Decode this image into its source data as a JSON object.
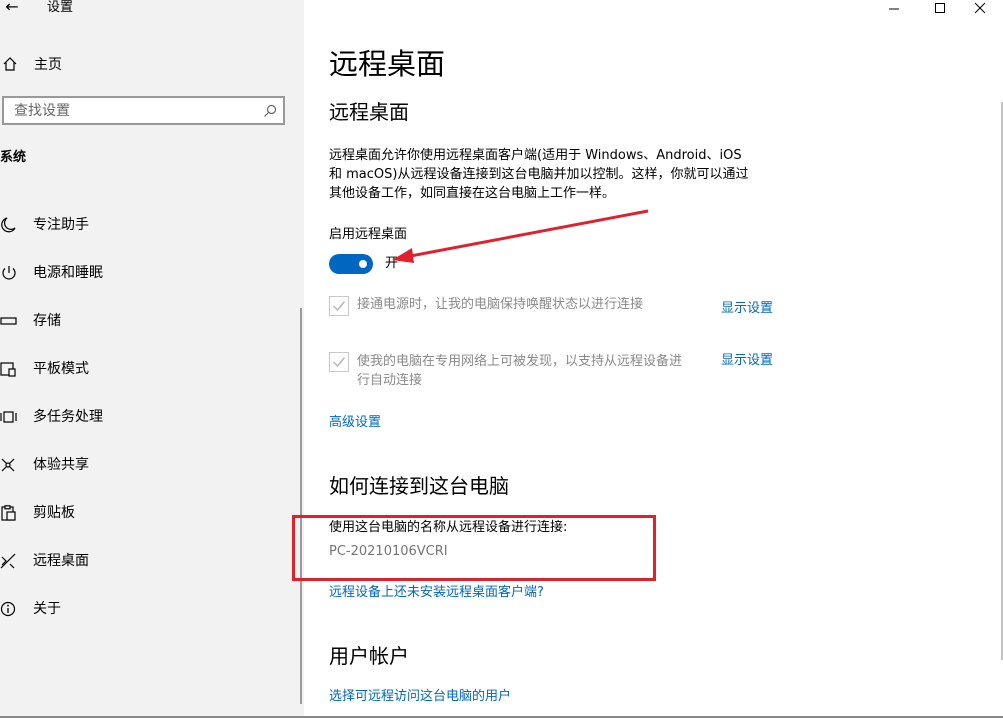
{
  "window": {
    "title": "设置",
    "controls": [
      "minimize-icon",
      "maximize-icon",
      "close-icon"
    ]
  },
  "sidebar": {
    "home_label": "主页",
    "search_placeholder": "查找设置",
    "section_label": "系统",
    "items": [
      {
        "label": "专注助手",
        "icon": "moon-icon"
      },
      {
        "label": "电源和睡眠",
        "icon": "power-icon"
      },
      {
        "label": "存储",
        "icon": "storage-icon"
      },
      {
        "label": "平板模式",
        "icon": "tablet-mode-icon"
      },
      {
        "label": "多任务处理",
        "icon": "multitasking-icon"
      },
      {
        "label": "体验共享",
        "icon": "shared-experiences-icon"
      },
      {
        "label": "剪贴板",
        "icon": "clipboard-icon"
      },
      {
        "label": "远程桌面",
        "icon": "remote-desktop-icon"
      },
      {
        "label": "关于",
        "icon": "info-icon"
      }
    ]
  },
  "content": {
    "page_title": "远程桌面",
    "section1": {
      "heading": "远程桌面",
      "description_lines": [
        "远程桌面允许你使用远程桌面客户端(适用于 Windows、Android、iOS",
        "和 macOS)从远程设备连接到这台电脑并加以控制。这样，你就可以通过",
        "其他设备工作，如同直接在这台电脑上工作一样。"
      ],
      "toggle_label": "启用远程桌面",
      "toggle_state": "开",
      "toggle_on": true,
      "options": [
        {
          "lines": [
            "接通电源时，让我的电脑保持唤醒状态以进行连接"
          ],
          "link": "显示设置",
          "checked": true
        },
        {
          "lines": [
            "使我的电脑在专用网络上可被发现，以支持从远程设备进",
            "行自动连接"
          ],
          "link": "显示设置",
          "checked": true
        }
      ],
      "advanced_link": "高级设置"
    },
    "section2": {
      "heading": "如何连接到这台电脑",
      "instruction": "使用这台电脑的名称从远程设备进行连接:",
      "pc_name": "PC-20210106VCRI",
      "client_link": "远程设备上还未安装远程桌面客户端?"
    },
    "section3": {
      "heading": "用户帐户",
      "users_link": "选择可远程访问这台电脑的用户"
    }
  },
  "colors": {
    "accent": "#0067c0",
    "annotation_red": "#e0212d",
    "sidebar_bg": "#f2f2f2"
  }
}
